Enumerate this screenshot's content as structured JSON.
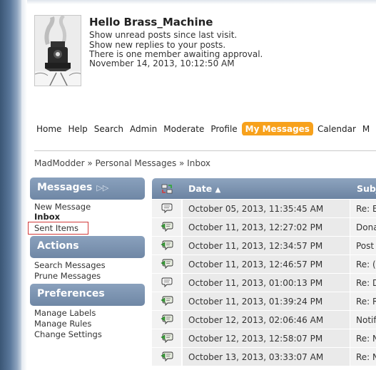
{
  "user": {
    "greeting": "Hello Brass_Machine",
    "lines": [
      "Show unread posts since last visit.",
      "Show new replies to your posts.",
      "There is one member awaiting approval.",
      "November 14, 2013, 10:12:50 AM"
    ]
  },
  "menu": [
    "Home",
    "Help",
    "Search",
    "Admin",
    "Moderate",
    "Profile",
    "My Messages",
    "Calendar",
    "M"
  ],
  "breadcrumb": "MadModder » Personal Messages » Inbox",
  "sidebar": {
    "messages_header": "Messages",
    "messages_links": [
      "New Message",
      "Inbox",
      "Sent Items"
    ],
    "actions_header": "Actions",
    "actions_links": [
      "Search Messages",
      "Prune Messages"
    ],
    "prefs_header": "Preferences",
    "prefs_links": [
      "Manage Labels",
      "Manage Rules",
      "Change Settings"
    ]
  },
  "table": {
    "date_header": "Date",
    "subject_header": "Subj",
    "rows": [
      {
        "date": "October 05, 2013, 11:35:45 AM",
        "subject": "Re: E",
        "icon": "message-icon"
      },
      {
        "date": "October 11, 2013, 12:27:02 PM",
        "subject": "Dona",
        "icon": "replied-message-icon"
      },
      {
        "date": "October 11, 2013, 12:34:57 PM",
        "subject": "Post",
        "icon": "replied-message-icon"
      },
      {
        "date": "October 11, 2013, 12:46:57 PM",
        "subject": "Re: (",
        "icon": "replied-message-icon"
      },
      {
        "date": "October 11, 2013, 01:00:13 PM",
        "subject": "Re: D",
        "icon": "message-icon"
      },
      {
        "date": "October 11, 2013, 01:39:24 PM",
        "subject": "Re: R",
        "icon": "replied-message-icon"
      },
      {
        "date": "October 12, 2013, 02:06:46 AM",
        "subject": "Notif",
        "icon": "replied-message-icon"
      },
      {
        "date": "October 12, 2013, 12:58:07 PM",
        "subject": "Re: N",
        "icon": "replied-message-icon"
      },
      {
        "date": "October 13, 2013, 03:33:07 AM",
        "subject": "Re: N",
        "icon": "replied-message-icon"
      }
    ]
  },
  "colors": {
    "active_tab": "#f7a11c",
    "header_blue": "#7a91af",
    "sent_items_highlight": "#d23a3a"
  }
}
